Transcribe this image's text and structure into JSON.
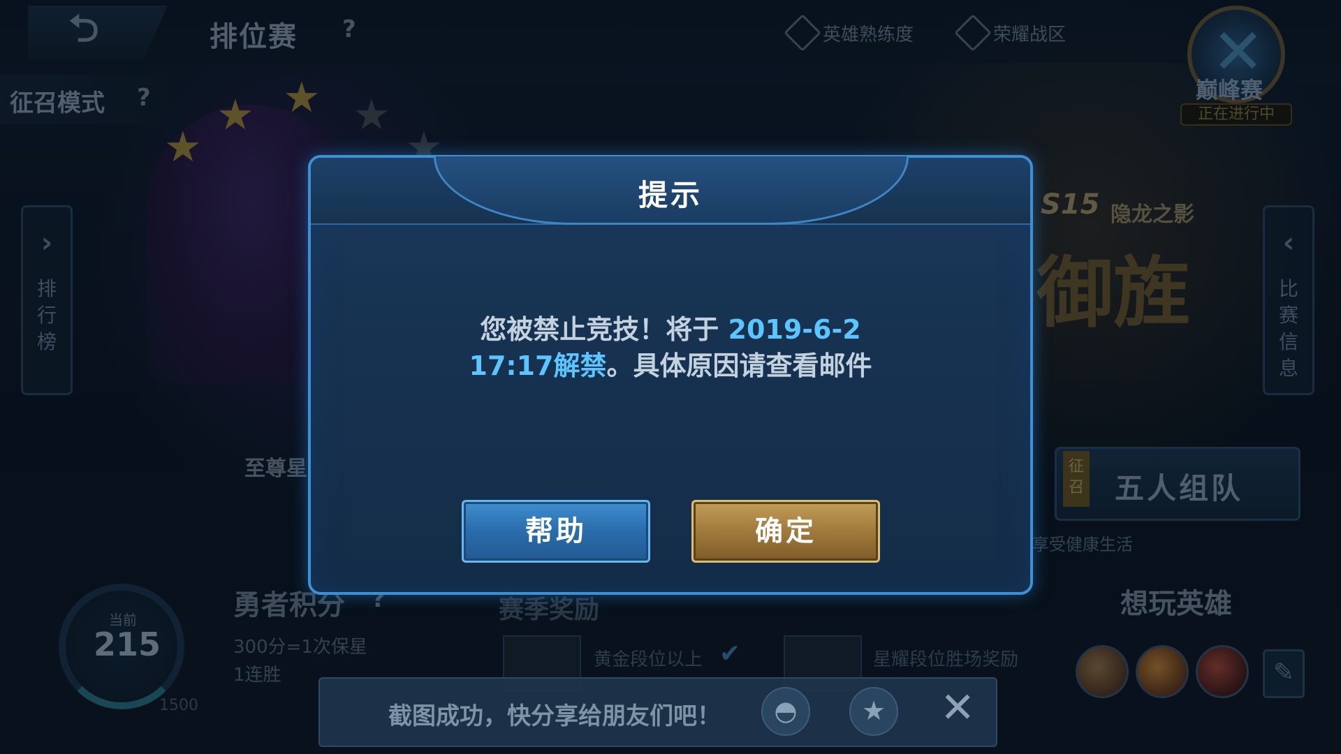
{
  "topbar": {
    "title": "排位赛",
    "links": [
      "英雄熟练度",
      "荣耀战区"
    ],
    "peak": {
      "label": "巅峰赛",
      "status": "正在进行中"
    }
  },
  "mode": {
    "label": "征召模式"
  },
  "left_tab": {
    "label": [
      "排",
      "行",
      "榜"
    ]
  },
  "right_tab": {
    "label": [
      "比",
      "赛",
      "信",
      "息"
    ]
  },
  "rank": {
    "name": "至尊星"
  },
  "season": {
    "code": "S15",
    "sub": "隐龙之影",
    "art": "御旌"
  },
  "team": {
    "tag": "征召",
    "label": "五人组队",
    "tip": "享受健康生活"
  },
  "want_heroes": {
    "title": "想玩英雄"
  },
  "points": {
    "caption": "当前",
    "value": "215",
    "max": "1500"
  },
  "brave": {
    "title": "勇者积分",
    "lines": [
      "300分=1次保星",
      "1连胜"
    ]
  },
  "rewards": {
    "title": "赛季奖励",
    "items": [
      "黄金段位以上",
      "星耀段位胜场奖励"
    ]
  },
  "modal": {
    "title": "提示",
    "message_pre": "您被禁止竞技！将于 ",
    "ban_date": "2019-6-2",
    "ban_time": "17:17",
    "unban_word": "解禁",
    "message_post": "。具体原因请查看邮件",
    "help_label": "帮助",
    "confirm_label": "确定"
  },
  "toast": {
    "text": "截图成功，快分享给朋友们吧！"
  },
  "colors": {
    "accent_blue": "#5cc4ff",
    "gold_button": "#a07a3c",
    "modal_border": "#3f8fd4"
  },
  "icons": [
    "back-arrow-icon",
    "help-icon",
    "proficiency-icon",
    "glory-zone-icon",
    "peak-emblem-icon",
    "qq-icon",
    "qzone-icon",
    "close-icon",
    "edit-icon"
  ]
}
